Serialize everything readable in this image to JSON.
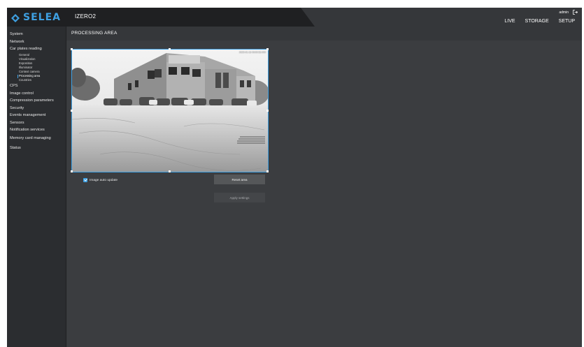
{
  "brand": {
    "name": "SELEA",
    "logo_icon": "diamond-logo-icon",
    "accent": "#3ea0e2"
  },
  "product": "IZERO2",
  "user": {
    "name": "admin",
    "logout_icon": "logout-icon"
  },
  "nav": {
    "live": "LIVE",
    "storage": "STORAGE",
    "setup": "SETUP"
  },
  "sidebar": {
    "system": "System",
    "network": "Network",
    "car_plates": "Car plates reading",
    "car_plates_sub": [
      "General",
      "Visualization",
      "Exposition",
      "Illuminator",
      "Context camera",
      "Processing area",
      "Countries"
    ],
    "cps": "CPS",
    "image_control": "Image control",
    "compression": "Compression parameters",
    "security": "Security",
    "events": "Events management",
    "sensors": "Sensors",
    "notification": "Notification services",
    "memory_card": "Memory card managing",
    "status": "Status"
  },
  "page": {
    "title": "PROCESSING AREA"
  },
  "preview": {
    "timestamp": "2025-01-16 09:00:53.000"
  },
  "controls": {
    "auto_update_label": "Image auto update",
    "auto_update_checked": true,
    "reset_label": "Reset area",
    "apply_label": "Apply settings"
  }
}
